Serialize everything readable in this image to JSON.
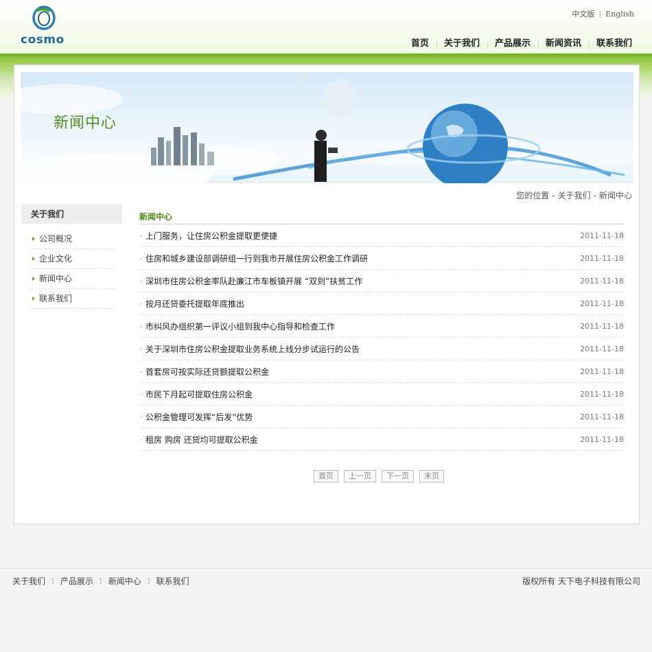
{
  "header": {
    "logo_text": "cosmo",
    "lang_cn": "中文版",
    "lang_en": "English",
    "nav": [
      "首页",
      "关于我们",
      "产品展示",
      "新闻资讯",
      "联系我们"
    ]
  },
  "banner": {
    "title": "新闻中心"
  },
  "breadcrumb": {
    "label": "您的位置",
    "level1": "关于我们",
    "level2": "新闻中心",
    "sep": "-"
  },
  "sidebar": {
    "title": "关于我们",
    "items": [
      "公司概况",
      "企业文化",
      "新闻中心",
      "联系我们"
    ]
  },
  "content": {
    "title": "新闻中心",
    "news": [
      {
        "title": "上门服务，让住房公积金提取更便捷",
        "date": "2011-11-18"
      },
      {
        "title": "住房和城乡建设部调研组一行到我市开展住房公积金工作调研",
        "date": "2011-11-18"
      },
      {
        "title": "深圳市住房公积金率队赴廉江市车板镇开展 “双到”扶贫工作",
        "date": "2011-11-18"
      },
      {
        "title": "按月还贷委托提取年底推出",
        "date": "2011-11-18"
      },
      {
        "title": "市纠风办组织第一评议小组到我中心指导和检查工作",
        "date": "2011-11-18"
      },
      {
        "title": "关于深圳市住房公积金提取业务系统上线分步试运行的公告",
        "date": "2011-11-18"
      },
      {
        "title": "首套房可按实际还贷额提取公积金",
        "date": "2011-11-18"
      },
      {
        "title": "市民下月起可提取住房公积金",
        "date": "2011-11-18"
      },
      {
        "title": "公积金管理可发挥“后发”优势",
        "date": "2011-11-18"
      },
      {
        "title": "租房 购房 还贷均可提取公积金",
        "date": "2011-11-18"
      }
    ],
    "pager": {
      "first": "首页",
      "prev": "上一页",
      "next": "下一页",
      "last": "末页"
    }
  },
  "footer": {
    "links": [
      "关于我们",
      "产品展示",
      "新闻中心",
      "联系我们"
    ],
    "copyright": "版权所有 天下电子科技有限公司"
  },
  "colors": {
    "accent_green": "#6cab21",
    "title_green": "#4d8a16",
    "bullet_orange": "#e07a1f"
  }
}
